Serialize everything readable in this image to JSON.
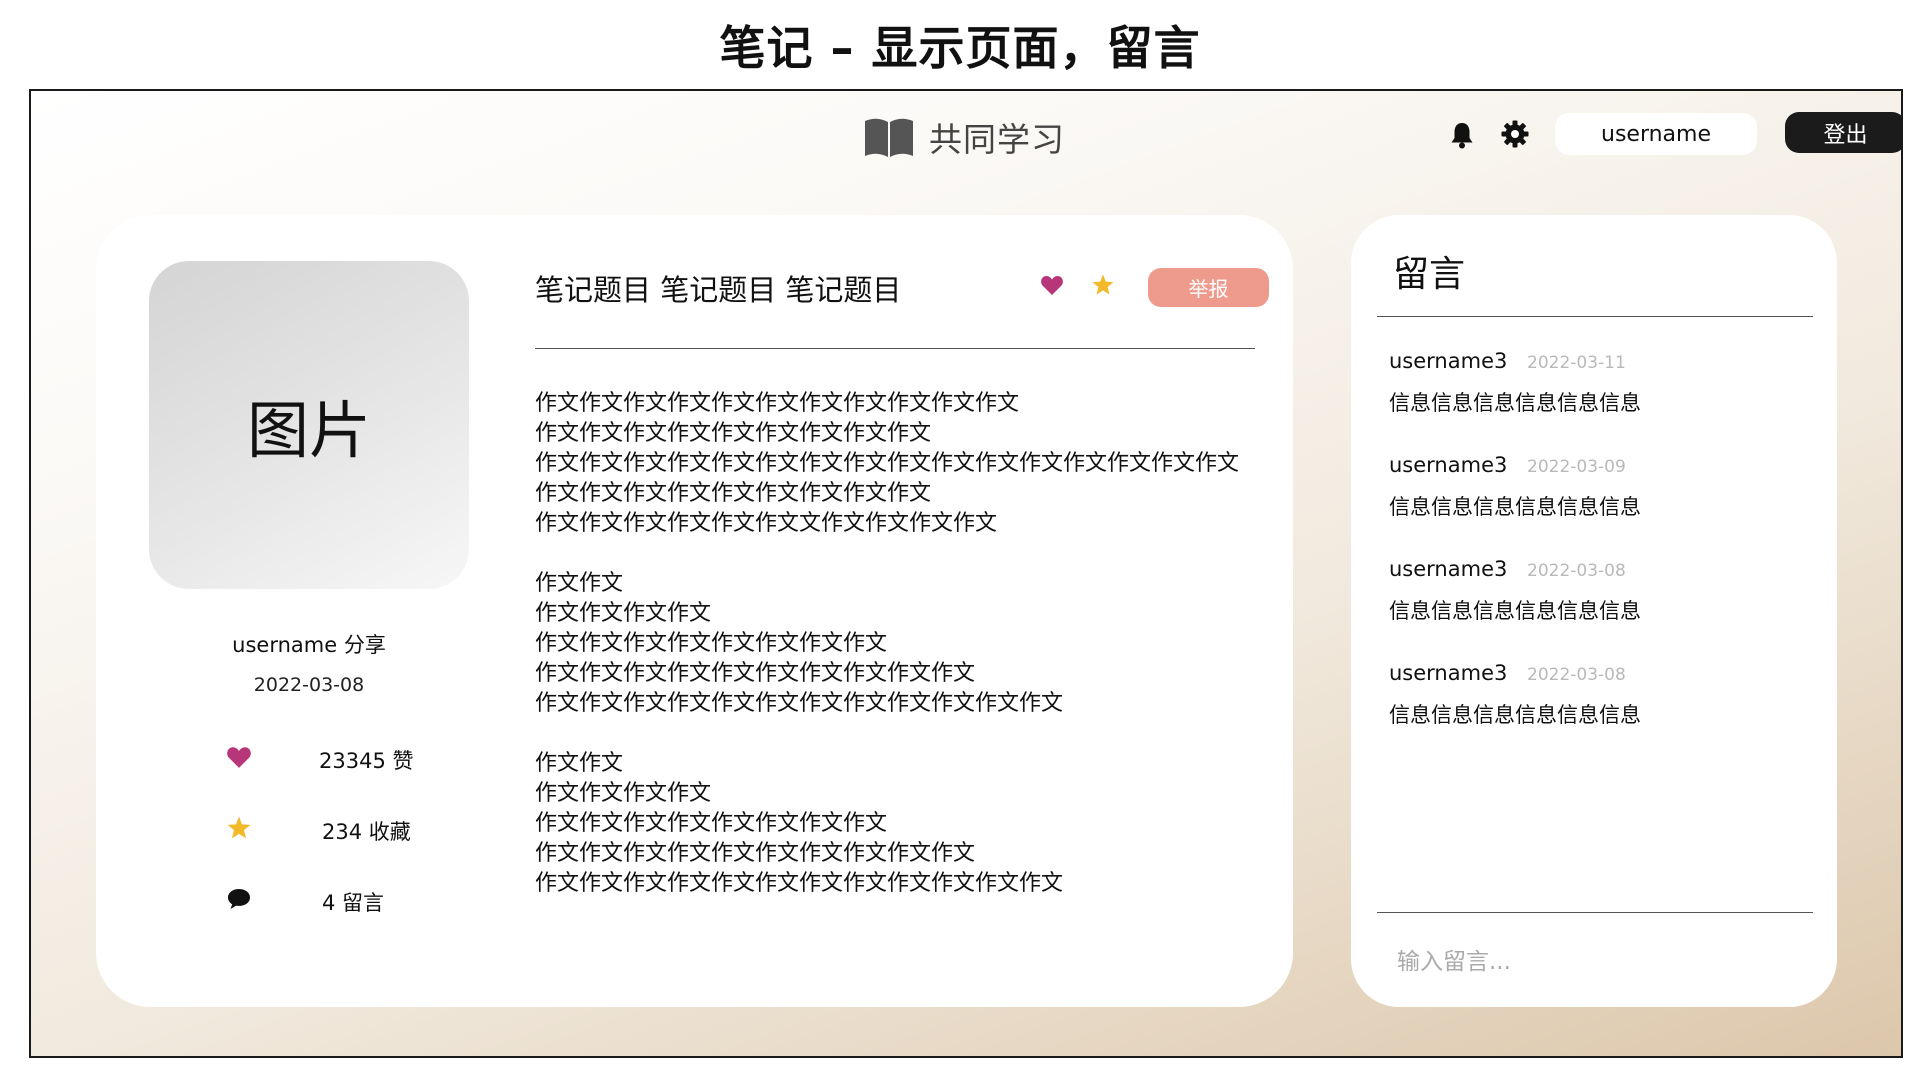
{
  "page_heading": "笔记 – 显示页面，留言",
  "app": {
    "name": "共同学习",
    "username": "username",
    "logout_label": "登出"
  },
  "colors": {
    "heart": "#b7367a",
    "star": "#f2b92a",
    "report": "#ee9b8d",
    "dark": "#1b1b1b"
  },
  "note": {
    "image_placeholder": "图片",
    "author": "username 分享",
    "date": "2022-03-08",
    "stats": {
      "likes": "23345 赞",
      "favorites": "234 收藏",
      "comments": "4 留言"
    },
    "title": "笔记题目 笔记题目 笔记题目",
    "report_label": "举报",
    "paragraphs": [
      [
        "作文作文作文作文作文作文作文作文作文作文作文",
        "作文作文作文作文作文作文作文作文作文",
        "作文作文作文作文作文作文作文作文作文作文作文作文作文作文作文作文",
        "作文作文作文作文作文作文作文作文作文",
        "作文作文作文作文作文作文文作文作文作文作文"
      ],
      [
        "作文作文",
        "作文作文作文作文",
        "作文作文作文作文作文作文作文作文",
        "作文作文作文作文作文作文作文作文作文作文",
        "作文作文作文作文作文作文作文作文作文作文作文作文"
      ],
      [
        "作文作文",
        "作文作文作文作文",
        "作文作文作文作文作文作文作文作文",
        "作文作文作文作文作文作文作文作文作文作文",
        "作文作文作文作文作文作文作文作文作文作文作文作文"
      ]
    ]
  },
  "comments": {
    "heading": "留言",
    "items": [
      {
        "user": "username3",
        "date": "2022-03-11",
        "text": "信息信息信息信息信息信息"
      },
      {
        "user": "username3",
        "date": "2022-03-09",
        "text": "信息信息信息信息信息信息"
      },
      {
        "user": "username3",
        "date": "2022-03-08",
        "text": "信息信息信息信息信息信息"
      },
      {
        "user": "username3",
        "date": "2022-03-08",
        "text": "信息信息信息信息信息信息"
      }
    ],
    "input_placeholder": "输入留言..."
  }
}
